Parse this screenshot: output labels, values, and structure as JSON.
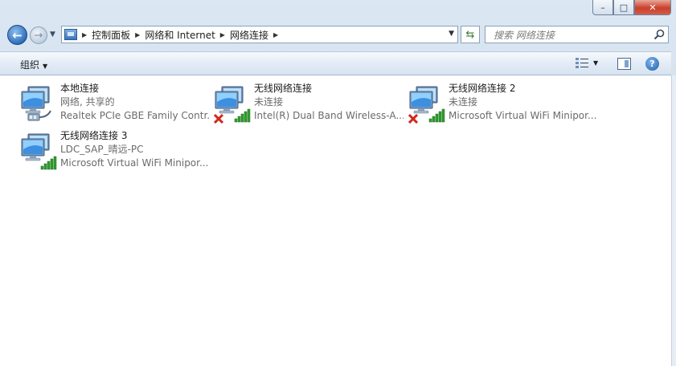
{
  "window": {
    "caption": {
      "minimize": "–",
      "maximize": "□",
      "close": "✕"
    }
  },
  "nav": {
    "back_glyph": "←",
    "forward_glyph": "→",
    "breadcrumb": [
      "控制面板",
      "网络和 Internet",
      "网络连接"
    ],
    "search": {
      "placeholder": "搜索 网络连接"
    },
    "icons": {
      "back": "back-arrow-icon",
      "forward": "forward-arrow-icon",
      "refresh": "refresh-icon",
      "search": "magnifier-icon"
    }
  },
  "toolbar": {
    "organize_label": "组织",
    "help_glyph": "?"
  },
  "connections": [
    {
      "name": "本地连接",
      "status": "网络, 共享的",
      "device": "Realtek PCIe GBE Family Contr...",
      "kind": "wired",
      "disconnected": false
    },
    {
      "name": "无线网络连接",
      "status": "未连接",
      "device": "Intel(R) Dual Band Wireless-A...",
      "kind": "wireless",
      "disconnected": true
    },
    {
      "name": "无线网络连接 2",
      "status": "未连接",
      "device": "Microsoft Virtual WiFi Minipor...",
      "kind": "wireless",
      "disconnected": true
    },
    {
      "name": "无线网络连接 3",
      "status": "LDC_SAP_晴远-PC",
      "device": "Microsoft Virtual WiFi Minipor...",
      "kind": "wireless",
      "disconnected": false
    }
  ],
  "colors": {
    "error_red": "#d1281c",
    "signal_green": "#2f9e2f",
    "accent_blue": "#2f6fbd"
  }
}
